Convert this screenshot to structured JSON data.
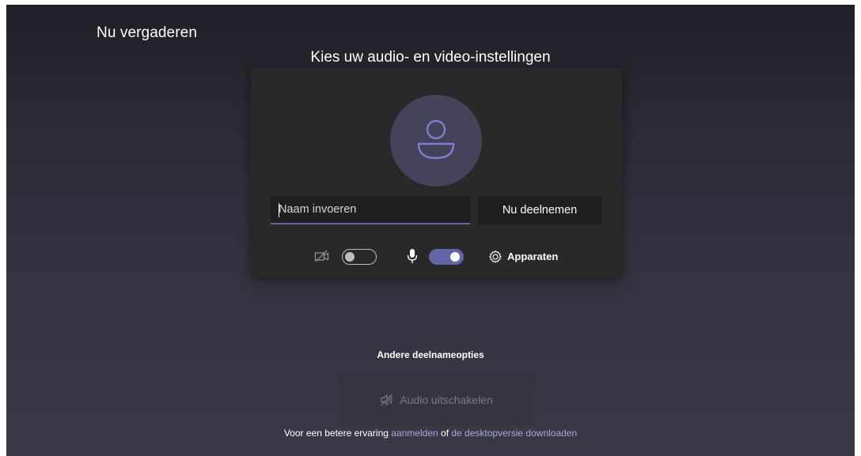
{
  "app": {
    "title": "Nu vergaderen"
  },
  "prejoin": {
    "heading": "Kies uw audio- en video-instellingen",
    "name_input": {
      "placeholder": "Naam invoeren",
      "value": ""
    },
    "join_button_label": "Nu deelnemen",
    "camera": {
      "icon": "camera-off-icon",
      "toggle_on": false
    },
    "microphone": {
      "icon": "microphone-icon",
      "toggle_on": true
    },
    "devices": {
      "icon": "gear-icon",
      "label": "Apparaten"
    },
    "avatar_icon": "person-icon"
  },
  "other_options": {
    "heading": "Andere deelnameopties",
    "audio_off": {
      "icon": "speaker-off-icon",
      "label": "Audio uitschakelen"
    }
  },
  "footer": {
    "text_before": "Voor een betere ervaring",
    "link_signin": "aanmelden",
    "text_middle": "of",
    "link_desktop": "de desktopversie downloaden"
  },
  "colors": {
    "accent": "#6264a7",
    "panel": "#292929",
    "link": "#a6a7dc"
  }
}
